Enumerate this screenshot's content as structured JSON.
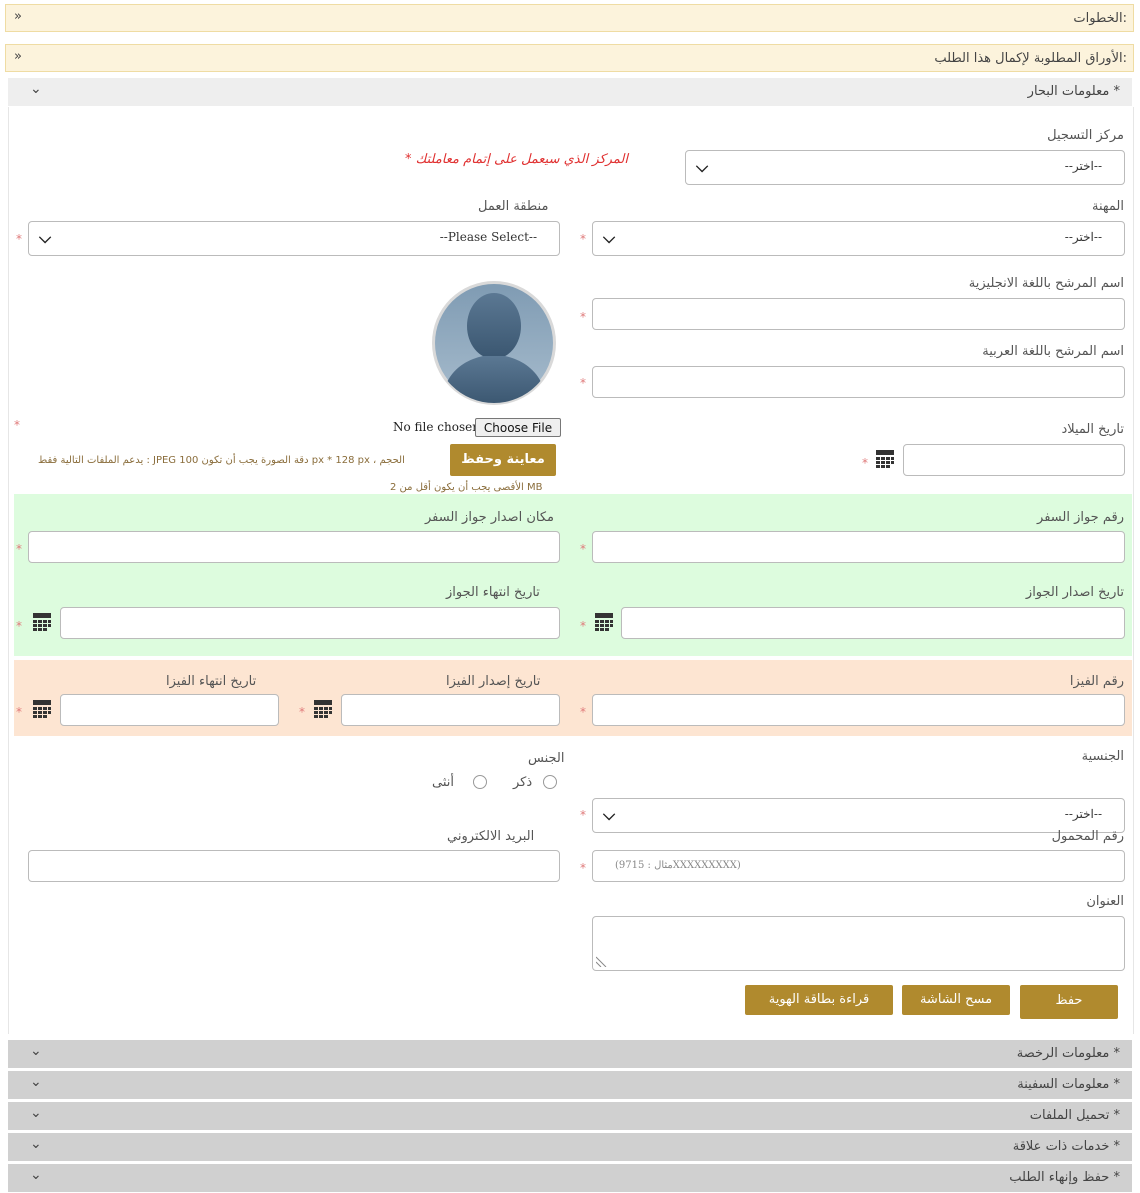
{
  "top_bars": [
    {
      "label": "الخطوات:"
    },
    {
      "label": "الأوراق المطلوبة لإكمال هذا الطلب:"
    }
  ],
  "sections": {
    "sailor": "معلومات البحار *",
    "license": "معلومات الرخصة *",
    "ship": "معلومات السفينة *",
    "upload": "تحميل الملفات *",
    "related": "خدمات ذات علاقة *",
    "finish": "حفظ وإنهاء الطلب *"
  },
  "form": {
    "registration_center": {
      "label": "مركز التسجيل",
      "value": "--اختر--",
      "note": "* المركز الذي سيعمل على إتمام معاملتك"
    },
    "profession": {
      "label": "المهنة",
      "value": "--اختر--"
    },
    "work_area": {
      "label": "منطقة العمل",
      "value": "--Please Select--"
    },
    "name_en": {
      "label": "اسم المرشح باللغة الانجليزية"
    },
    "name_ar": {
      "label": "اسم المرشح باللغة العربية"
    },
    "birth_date": {
      "label": "تاريخ الميلاد"
    },
    "photo": {
      "no_file": "No file chosen",
      "choose_button": "Choose File",
      "preview_button": "معاينة وحفظ",
      "hint_line1": "يدعم الملفات التالية فقط : JPEG دقة الصورة يجب أن تكون 100 px * 128 px ، الحجم",
      "hint_line2": "الأقصى يجب أن يكون أقل من 2 MB"
    },
    "passport_number": {
      "label": "رقم جواز السفر"
    },
    "passport_issue_place": {
      "label": "مكان اصدار جواز السفر"
    },
    "passport_issue_date": {
      "label": "تاريخ اصدار الجواز"
    },
    "passport_expiry_date": {
      "label": "تاريخ انتهاء الجواز"
    },
    "visa_number": {
      "label": "رقم الفيزا"
    },
    "visa_issue_date": {
      "label": "تاريخ إصدار الفيزا"
    },
    "visa_expiry_date": {
      "label": "تاريخ انتهاء الفيزا"
    },
    "nationality": {
      "label": "الجنسية",
      "value": "--اختر--"
    },
    "gender": {
      "label": "الجنس",
      "male": "ذكر",
      "female": "أنثى"
    },
    "mobile": {
      "label": "رقم المحمول",
      "placeholder": "(مثال : 9715XXXXXXXXX)"
    },
    "email": {
      "label": "البريد الالكتروني"
    },
    "address": {
      "label": "العنوان"
    }
  },
  "actions": {
    "save": "حفظ",
    "clear": "مسح الشاشة",
    "read_id": "قراءة بطاقة الهوية"
  },
  "colors": {
    "accent": "#b08a2e",
    "passport_band": "#ddfcde",
    "visa_band": "#fde5d2",
    "required_star": "#e07a7a",
    "note_red": "#e03030"
  }
}
